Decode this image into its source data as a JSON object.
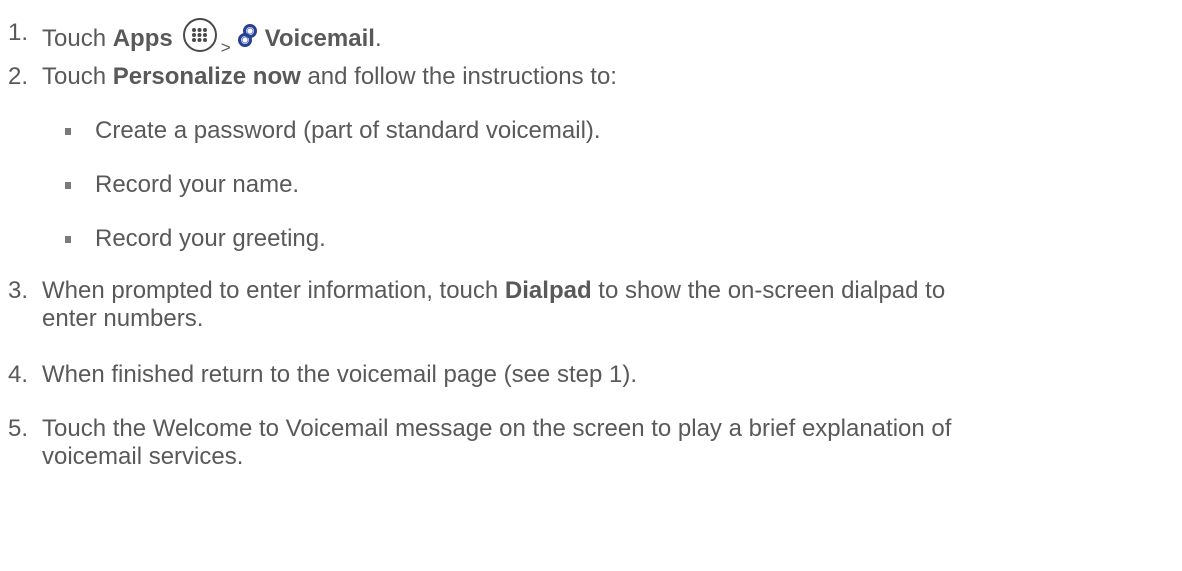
{
  "steps": [
    {
      "num": "1.",
      "pre": "Touch ",
      "bold1": "Apps",
      "sep": ">",
      "bold2": "Voicemail",
      "post": "."
    },
    {
      "num": "2.",
      "pre": "Touch ",
      "bold": "Personalize now",
      "post": " and follow the instructions to:"
    },
    {
      "num": "3.",
      "pre": "When prompted to enter information, touch ",
      "bold": "Dialpad",
      "post": " to show the on-screen dialpad to",
      "line2": "enter numbers."
    },
    {
      "num": "4.",
      "text": "When finished return to the voicemail page (see step 1)."
    },
    {
      "num": "5.",
      "text": "Touch the Welcome to Voicemail message on the screen to play a brief explanation of",
      "line2": "voicemail services."
    }
  ],
  "bullets": [
    "Create a password (part of standard voicemail).",
    "Record your name.",
    "Record your greeting."
  ],
  "icons": {
    "apps": "apps-grid-icon",
    "voicemail": "voicemail-icon"
  }
}
